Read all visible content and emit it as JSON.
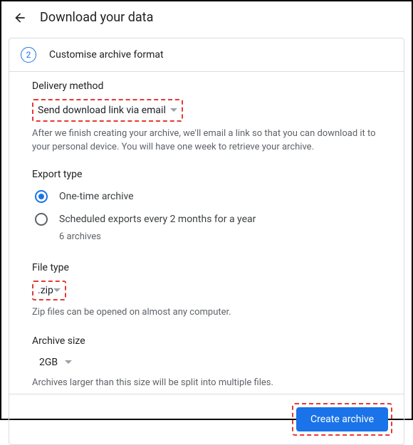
{
  "header": {
    "title": "Download your data"
  },
  "step": {
    "number": "2",
    "title": "Customise archive format"
  },
  "delivery": {
    "label": "Delivery method",
    "selected": "Send download link via email",
    "helper": "After we finish creating your archive, we'll email a link so that you can download it to your personal device. You will have one week to retrieve your archive."
  },
  "export": {
    "label": "Export type",
    "options": {
      "once": "One-time archive",
      "scheduled": "Scheduled exports every 2 months for a year",
      "scheduled_note": "6 archives"
    }
  },
  "filetype": {
    "label": "File type",
    "selected": ".zip",
    "helper": "Zip files can be opened on almost any computer."
  },
  "archivesize": {
    "label": "Archive size",
    "selected": "2GB",
    "helper": "Archives larger than this size will be split into multiple files."
  },
  "actions": {
    "create": "Create archive"
  }
}
